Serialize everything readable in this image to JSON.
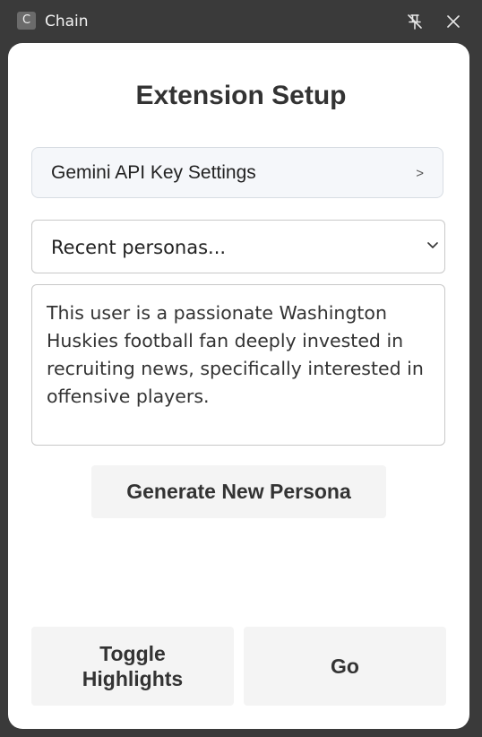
{
  "window": {
    "icon_letter": "C",
    "title": "Chain"
  },
  "page": {
    "heading": "Extension Setup"
  },
  "api_settings": {
    "label": "Gemini API Key Settings",
    "arrow": ">"
  },
  "persona_select": {
    "selected": "Recent personas..."
  },
  "persona_text": {
    "value": "This user is a passionate Washington Huskies football fan deeply invested in recruiting news, specifically interested in offensive players."
  },
  "buttons": {
    "generate": "Generate New Persona",
    "toggle_line1": "Toggle",
    "toggle_line2": "Highlights",
    "go": "Go"
  },
  "icons": {
    "app": "app-icon",
    "pin": "unpin-icon",
    "close": "close-icon",
    "chevron": "chevron-down-icon"
  }
}
